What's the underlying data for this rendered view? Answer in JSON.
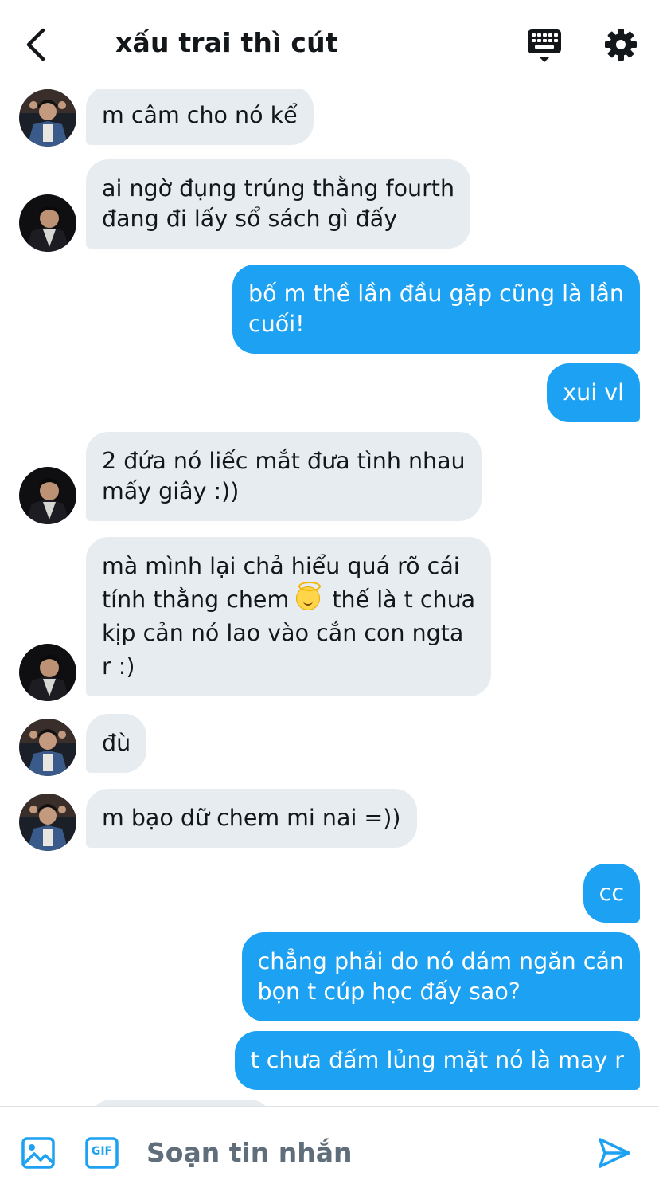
{
  "header": {
    "title": "xấu trai thì cút"
  },
  "icons": {
    "back": "chevron-left-icon",
    "keyboard": "keyboard-icon",
    "settings": "gear-icon",
    "image": "image-icon",
    "gif": "gif-icon",
    "send": "send-icon"
  },
  "messages": [
    {
      "dir": "in",
      "lines": [
        "m câm cho nó kể"
      ]
    },
    {
      "dir": "in",
      "lines": [
        "ai ngờ đụng trúng thằng fourth",
        "đang đi lấy sổ sách gì đấy"
      ]
    },
    {
      "dir": "out",
      "lines": [
        "bố m thề lần đầu gặp cũng là lần",
        "cuối!"
      ]
    },
    {
      "dir": "out",
      "lines": [
        "xui vl"
      ]
    },
    {
      "dir": "in",
      "lines": [
        "2 đứa nó liếc mắt đưa tình nhau",
        "mấy giây :))"
      ]
    },
    {
      "dir": "in",
      "lines": [
        "mà mình lại chả hiểu quá rõ cái",
        "tính thằng chem",
        "thế là t chưa",
        "kịp cản nó lao vào cắn con ngta",
        "r :)"
      ]
    },
    {
      "dir": "in",
      "lines": [
        "đù"
      ]
    },
    {
      "dir": "in",
      "lines": [
        "m bạo dữ chem mi nai =))"
      ]
    },
    {
      "dir": "out",
      "lines": [
        "cc"
      ]
    },
    {
      "dir": "out",
      "lines": [
        "chẳng phải do nó dám ngăn cản",
        "bọn t cúp học đấy sao?"
      ]
    },
    {
      "dir": "out",
      "lines": [
        "t chưa đấm lủng mặt nó là may r"
      ]
    }
  ],
  "composer": {
    "placeholder": "Soạn tin nhắn",
    "gif_label": "GIF"
  },
  "colors": {
    "accent": "#1da1f2",
    "incoming_bubble": "#e6ecf0",
    "text": "#14171a",
    "placeholder": "#5f6e7a"
  }
}
